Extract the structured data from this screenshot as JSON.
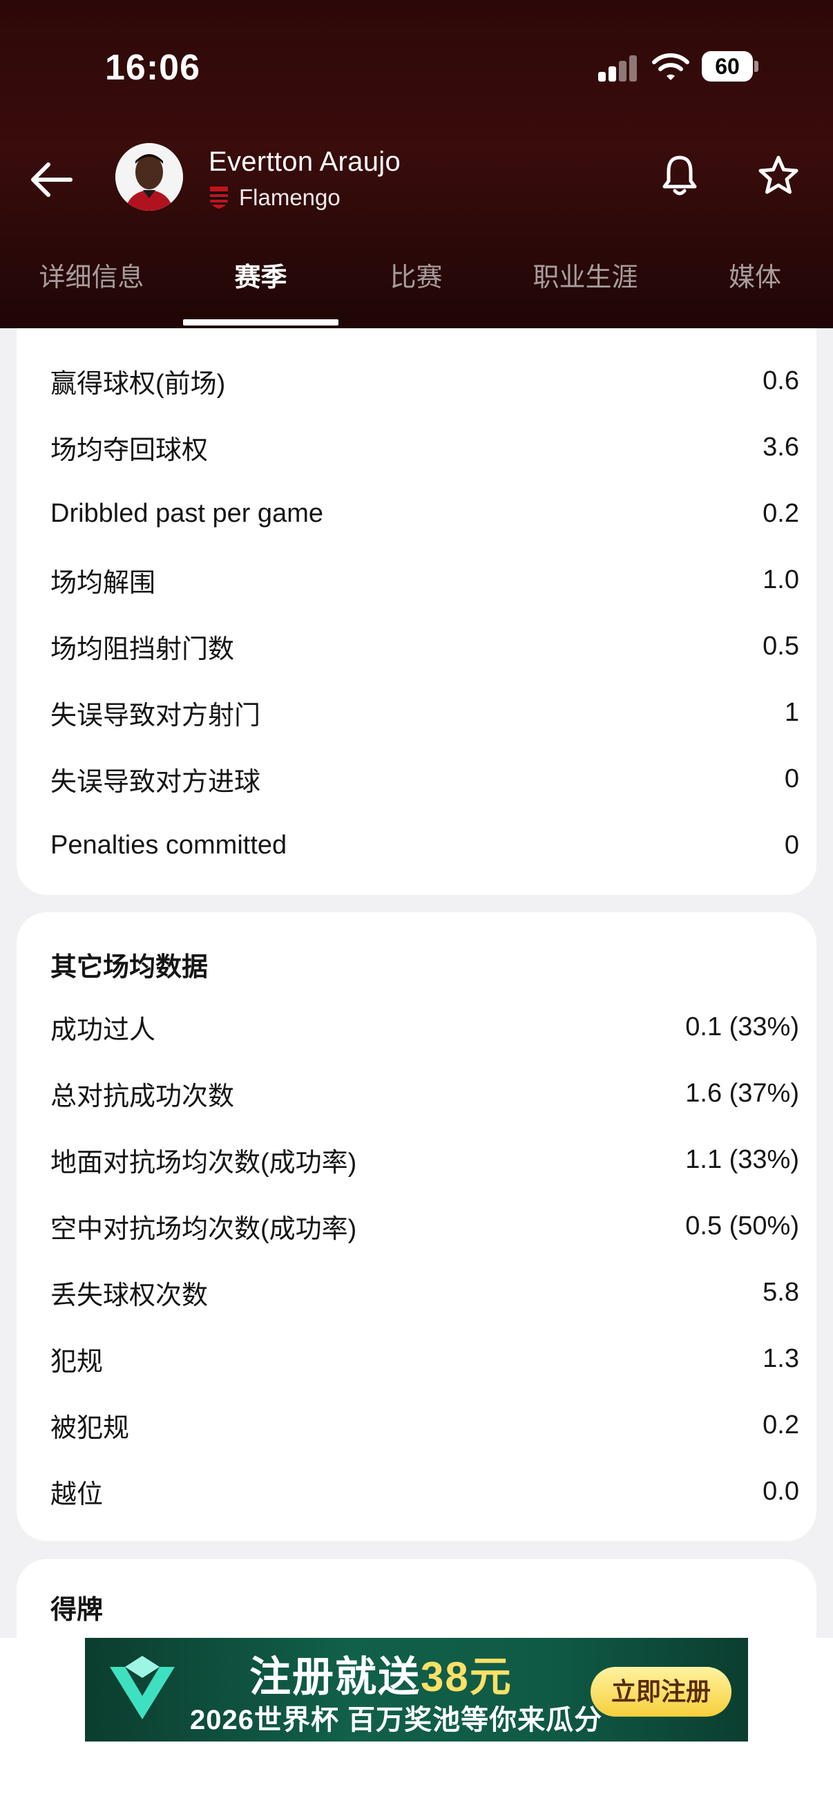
{
  "status_bar": {
    "time": "16:06",
    "battery": "60"
  },
  "header": {
    "player_name": "Evertton Araujo",
    "team_name": "Flamengo",
    "icons": {
      "back": "arrow-left-icon",
      "notify": "bell-icon",
      "favorite": "star-icon"
    }
  },
  "tabs": [
    {
      "label": "详细信息",
      "active": false
    },
    {
      "label": "赛季",
      "active": true
    },
    {
      "label": "比赛",
      "active": false
    },
    {
      "label": "职业生涯",
      "active": false
    },
    {
      "label": "媒体",
      "active": false
    }
  ],
  "defense_card": {
    "rows": [
      {
        "label": "赢得球权(前场)",
        "value": "0.6"
      },
      {
        "label": "场均夺回球权",
        "value": "3.6"
      },
      {
        "label": "Dribbled past per game",
        "value": "0.2"
      },
      {
        "label": "场均解围",
        "value": "1.0"
      },
      {
        "label": "场均阻挡射门数",
        "value": "0.5"
      },
      {
        "label": "失误导致对方射门",
        "value": "1"
      },
      {
        "label": "失误导致对方进球",
        "value": "0"
      },
      {
        "label": "Penalties committed",
        "value": "0"
      }
    ]
  },
  "other_card": {
    "title": "其它场均数据",
    "rows": [
      {
        "label": "成功过人",
        "value": "0.1 (33%)"
      },
      {
        "label": "总对抗成功次数",
        "value": "1.6 (37%)"
      },
      {
        "label": "地面对抗场均次数(成功率)",
        "value": "1.1 (33%)"
      },
      {
        "label": "空中对抗场均次数(成功率)",
        "value": "0.5 (50%)"
      },
      {
        "label": "丢失球权次数",
        "value": "5.8"
      },
      {
        "label": "犯规",
        "value": "1.3"
      },
      {
        "label": "被犯规",
        "value": "0.2"
      },
      {
        "label": "越位",
        "value": "0.0"
      }
    ]
  },
  "cards_card": {
    "title": "得牌"
  },
  "ad": {
    "title_prefix": "注册就送",
    "title_highlight": "38元",
    "subtitle": "2026世界杯 百万奖池等你来瓜分",
    "cta": "立即注册"
  },
  "colors": {
    "header_bg": "#2d0808",
    "accent": "#ffffff",
    "ad_bg": "#11604a",
    "ad_cta": "#f7cf3b"
  }
}
